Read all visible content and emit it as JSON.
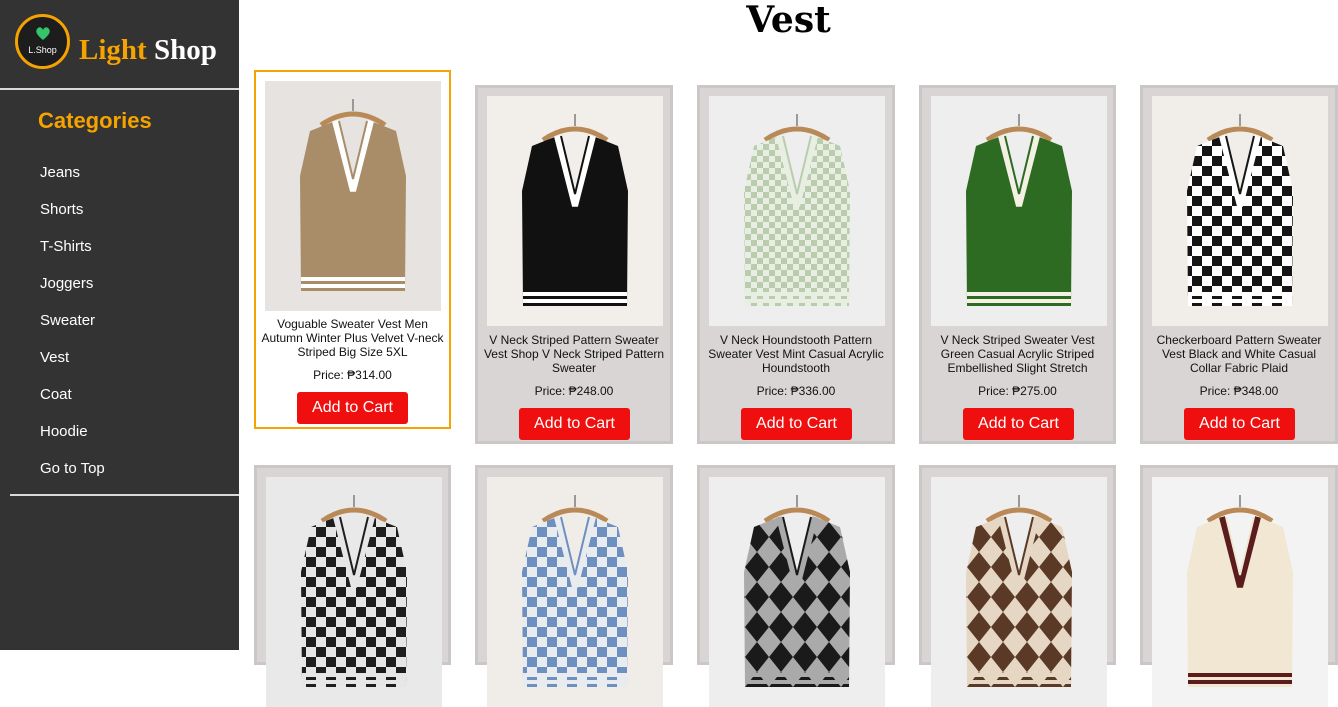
{
  "brand": {
    "logo_text": "L.Shop",
    "name_part1": "Light",
    "name_part2": "Shop"
  },
  "sidebar": {
    "title": "Categories",
    "items": [
      {
        "label": "Jeans"
      },
      {
        "label": "Shorts"
      },
      {
        "label": "T-Shirts"
      },
      {
        "label": "Joggers"
      },
      {
        "label": "Sweater"
      },
      {
        "label": "Vest"
      },
      {
        "label": "Coat"
      },
      {
        "label": "Hoodie"
      },
      {
        "label": "Go to Top"
      }
    ]
  },
  "page": {
    "title": "Vest"
  },
  "products": [
    {
      "name": "Voguable Sweater Vest Men Autumn Winter Plus Velvet V-neck Striped Big Size 5XL",
      "price": "Price: ₱314.00",
      "button": "Add to Cart",
      "colors": {
        "body": "#a88d68",
        "stripe": "#ffffff",
        "bg": "#e6e3e0"
      }
    },
    {
      "name": "V Neck Striped Pattern Sweater Vest Shop V Neck Striped Pattern Sweater",
      "price": "Price: ₱248.00",
      "button": "Add to Cart",
      "colors": {
        "body": "#111111",
        "stripe": "#ffffff",
        "bg": "#f2efea"
      }
    },
    {
      "name": "V Neck Houndstooth Pattern Sweater Vest Mint Casual Acrylic Houndstooth",
      "price": "Price: ₱336.00",
      "button": "Add to Cart",
      "colors": {
        "body": "#b9cdae",
        "stripe": "#e8efe2",
        "bg": "#eeeeee"
      }
    },
    {
      "name": "V Neck Striped Sweater Vest Green Casual Acrylic Striped Embellished Slight Stretch",
      "price": "Price: ₱275.00",
      "button": "Add to Cart",
      "colors": {
        "body": "#2d6b22",
        "stripe": "#f4f0e4",
        "bg": "#eeeeee"
      }
    },
    {
      "name": "Checkerboard Pattern Sweater Vest Black and White Casual Collar Fabric Plaid",
      "price": "Price: ₱348.00",
      "button": "Add to Cart",
      "colors": {
        "body": "#151515",
        "stripe": "#ffffff",
        "bg": "#f1eeea"
      }
    },
    {
      "name": "",
      "price": "",
      "button": "",
      "colors": {
        "body": "#1e1e1e",
        "stripe": "#e6e6e6",
        "bg": "#e9e9e9"
      }
    },
    {
      "name": "",
      "price": "",
      "button": "",
      "colors": {
        "body": "#6e90c1",
        "stripe": "#e9ecef",
        "bg": "#f0ede8"
      }
    },
    {
      "name": "",
      "price": "",
      "button": "",
      "colors": {
        "body": "#1a1a1a",
        "stripe": "#aaaaaa",
        "bg": "#eeeeee"
      }
    },
    {
      "name": "",
      "price": "",
      "button": "",
      "colors": {
        "body": "#5a3a26",
        "stripe": "#e5d7c4",
        "bg": "#eeeeee"
      }
    },
    {
      "name": "",
      "price": "",
      "button": "",
      "colors": {
        "body": "#f1e7d3",
        "stripe": "#5a1c1c",
        "bg": "#f3f3f3"
      }
    }
  ]
}
